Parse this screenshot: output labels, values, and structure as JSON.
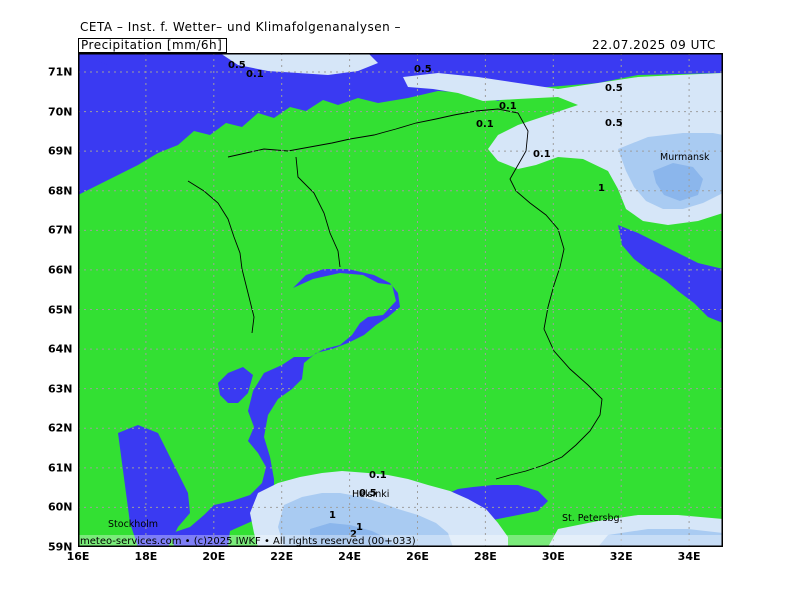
{
  "header": {
    "organization": "CETA – Inst. f. Wetter– und Klimafolgenanalysen –",
    "parameter": "Precipitation [mm/6h]",
    "valid_time": "22.07.2025 09 UTC"
  },
  "footer": {
    "credit": "meteo-services.com • (c)2025 IWKF • All rights reserved (00+033)"
  },
  "axes": {
    "lat_labels": [
      "71N",
      "70N",
      "69N",
      "68N",
      "67N",
      "66N",
      "65N",
      "64N",
      "63N",
      "62N",
      "61N",
      "60N",
      "59N"
    ],
    "lon_labels": [
      "16E",
      "18E",
      "20E",
      "22E",
      "24E",
      "26E",
      "28E",
      "30E",
      "32E",
      "34E"
    ]
  },
  "cities": [
    {
      "name": "Murmansk"
    },
    {
      "name": "Helsinki"
    },
    {
      "name": "Stockholm"
    },
    {
      "name": "St. Petersbg."
    }
  ],
  "contour_labels": [
    "0.5",
    "0.1",
    "0.5",
    "0.1",
    "0.1",
    "0.5",
    "0.5",
    "0.1",
    "1",
    "0.1",
    "0.5",
    "1",
    "1",
    "2"
  ],
  "colors": {
    "land": "#33e033",
    "sea": "#3a3af2",
    "precip_0_1": "#d6e6f8",
    "precip_0_5": "#a9cbf2",
    "precip_1": "#8bb6ec",
    "grid": "#9e9e9e"
  }
}
